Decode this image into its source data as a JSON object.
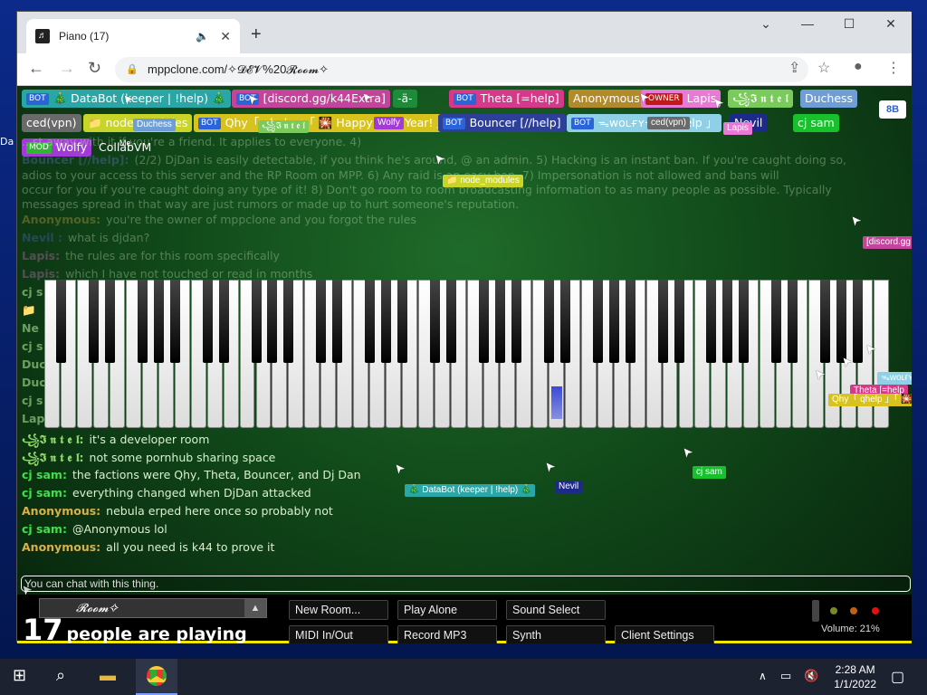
{
  "browser": {
    "tab_icon": "♬",
    "tab_title": "Piano (17)",
    "audio_icon": "🔈",
    "close_tab": "✕",
    "new_tab": "+",
    "url": "mppclone.com/✧𝓓𝓔𝓥%20𝓡𝓸𝓸𝓶✧",
    "window_controls": [
      "⌄",
      "—",
      "☐",
      "✕"
    ]
  },
  "desktop": {
    "side_text": "Da"
  },
  "users": [
    {
      "label": "🎄 DataBot (keeper | !help) 🎄",
      "bot": true,
      "color": "#2ba6a6"
    },
    {
      "label": "[discord.gg/k44Extra]",
      "bot": true,
      "color": "#c4449c"
    },
    {
      "label": "-ä-",
      "bot": false,
      "color": "#1e8b3a"
    },
    {
      "label": "Theta [=help]",
      "bot": true,
      "color": "#d6398a"
    },
    {
      "label": "Anonymous",
      "bot": false,
      "color": "#b28a2a"
    },
    {
      "label": "Lapis",
      "owner": true,
      "color": "#e87ad6"
    },
    {
      "label": "꧁𝕴 𝖓 𝖙 𝖊 𝖑",
      "bot": false,
      "color": "#7acb5c"
    },
    {
      "label": "Duchess",
      "bot": false,
      "color": "#6f9ed6"
    },
    {
      "label": "ced(vpn)",
      "bot": false,
      "color": "#6a6a6a"
    },
    {
      "label": "📁 node_modules",
      "bot": false,
      "color": "#c8d42a"
    },
    {
      "label": "Qhy「 qhelp 」「 🎇 Happy New Year! 」",
      "bot": true,
      "color": "#d8c21e"
    },
    {
      "label": "Bouncer [//help]",
      "bot": true,
      "color": "#2e3f9a"
    },
    {
      "label": "ᯓᴡᴏʟғʏᯓ「 ahelp 」",
      "bot": true,
      "color": "#8fd0e6"
    },
    {
      "label": "Nevil",
      "bot": false,
      "color": "#1e2a8a"
    },
    {
      "label": "cj sam",
      "bot": false,
      "color": "#18c02e"
    },
    {
      "label": "Wolfy",
      "mod": true,
      "color": "#a23bd6"
    },
    {
      "label": "CollabVM",
      "bot": false,
      "color": "transparent"
    }
  ],
  "tags": {
    "bot": "BOT",
    "owner": "OWNER",
    "mod": "MOD",
    "me": "Me"
  },
  "chat_faint": [
    {
      "name": "",
      "text": "...st away with it if you're a friend. It applies to everyone. 4)",
      "color": "#9bd28a"
    },
    {
      "name": "Bouncer [//help]:",
      "text": "(2/2) DjDan is easily detectable, if you think he's around, @ an admin. 5) Hacking is an instant ban. If you're caught doing so,",
      "color": "#6a7ad6"
    },
    {
      "name": "",
      "text": "adios to your access to this server and the RP Room on MPP. 6) Any raid is an easy ban. 7) Impersonation is not allowed and bans will",
      "color": "#fff"
    },
    {
      "name": "",
      "text": "occur for you if you're caught doing any type of it! 8) Don't go room to room broadcasting information to as many people as possible. Typically",
      "color": "#fff"
    },
    {
      "name": "",
      "text": "messages spread in that way are just rumors or made up to hurt someone's reputation.",
      "color": "#fff"
    },
    {
      "name": "Anonymous:",
      "text": "you're the owner of mppclone and you forgot the rules",
      "color": "#d8b04a"
    },
    {
      "name": "Nevil :",
      "text": "what is djdan?",
      "color": "#5a6ad6"
    },
    {
      "name": "Lapis:",
      "text": "the rules are for this room specifically",
      "color": "#e87ad6"
    },
    {
      "name": "Lapis:",
      "text": "which I have not touched or read in months",
      "color": "#e87ad6"
    }
  ],
  "chat": [
    {
      "name": "꧁𝕴 𝖓 𝖙 𝖊 𝖑:",
      "text": "it's a developer room",
      "color": "#8fd86a"
    },
    {
      "name": "꧁𝕴 𝖓 𝖙 𝖊 𝖑:",
      "text": "not some pornhub sharing space",
      "color": "#8fd86a"
    },
    {
      "name": "cj sam:",
      "text": "the factions were Qhy, Theta, Bouncer, and Dj Dan",
      "color": "#3ee04a"
    },
    {
      "name": "cj sam:",
      "text": "everything changed when DjDan attacked",
      "color": "#3ee04a"
    },
    {
      "name": "Anonymous:",
      "text": "nebula erped here once so probably not",
      "color": "#d8b04a"
    },
    {
      "name": "cj sam:",
      "text": "@Anonymous lol",
      "color": "#3ee04a"
    },
    {
      "name": "Anonymous:",
      "text": "all you need is k44 to prove it",
      "color": "#d8b04a"
    }
  ],
  "chat_partial_left": [
    "cj s",
    "📁",
    "Ne",
    "cj s",
    "Duc",
    "Duc",
    "cj s",
    "Lap"
  ],
  "floating_labels": [
    {
      "text": "Duchess",
      "color": "#6f9ed6"
    },
    {
      "text": "꧁𝕴 𝖓 𝖙 𝖊 𝖑",
      "color": "#7acb5c"
    },
    {
      "text": "Wolfy",
      "color": "#a23bd6"
    },
    {
      "text": "ced(vpn)",
      "color": "#6a6a6a"
    },
    {
      "text": "Lapis",
      "color": "#e87ad6"
    },
    {
      "text": "📁 node_modules",
      "color": "#c8d42a"
    },
    {
      "text": "[discord.gg",
      "color": "#c4449c"
    },
    {
      "text": "ᯓᴡᴏʟғʏ",
      "color": "#8fd0e6"
    },
    {
      "text": "Theta [=help",
      "color": "#d6398a"
    },
    {
      "text": "Qhy「 qhelp 」「 🎇",
      "color": "#d8c21e"
    },
    {
      "text": "🎄 DataBot (keeper | !help) 🎄",
      "color": "#2ba6a6"
    },
    {
      "text": "Nevil",
      "color": "#1e2a8a"
    },
    {
      "text": "cj sam",
      "color": "#18c02e"
    },
    {
      "text": "Anonymous",
      "color": "#b28a2a"
    }
  ],
  "chat_input_placeholder": "You can chat with this thing.",
  "room": {
    "name": "𝓡𝓸𝓸𝓶✧",
    "arrow": "▲"
  },
  "players": {
    "count": "17",
    "text": "people are playing"
  },
  "buttons": {
    "new_room": "New Room...",
    "play_alone": "Play Alone",
    "sound_select": "Sound Select",
    "midi": "MIDI In/Out",
    "record": "Record MP3",
    "synth": "Synth",
    "client_settings": "Client Settings"
  },
  "volume": {
    "label": "Volume: 21%",
    "level": 0.21
  },
  "top_right_badge": "8B",
  "taskbar": {
    "time": "2:28 AM",
    "date": "1/1/2022"
  }
}
